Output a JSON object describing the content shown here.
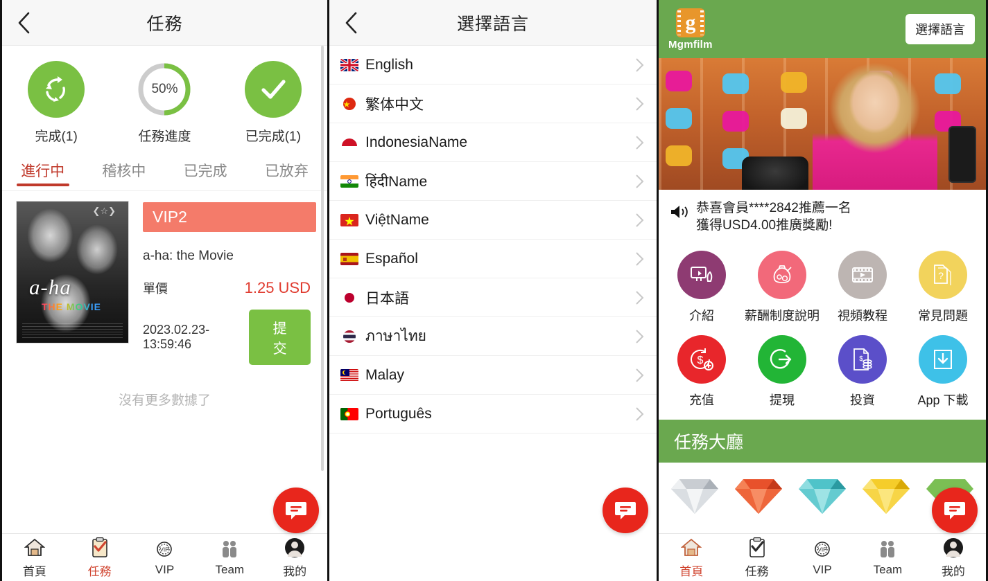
{
  "panel_tasks": {
    "navbar": {
      "title": "任務",
      "back_icon": "chevron-left-icon"
    },
    "stats": [
      {
        "label": "完成(1)",
        "icon": "recycle-arrows-icon",
        "type": "circle",
        "color": "#7ac043"
      },
      {
        "label": "任務進度",
        "value": "50%",
        "percent": 50,
        "type": "ring",
        "track_color": "#cccccc",
        "fill_color": "#7ac043"
      },
      {
        "label": "已完成(1)",
        "icon": "check-icon",
        "type": "circle",
        "color": "#7ac043"
      }
    ],
    "tabs": [
      {
        "label": "進行中",
        "active": true
      },
      {
        "label": "稽核中",
        "active": false
      },
      {
        "label": "已完成",
        "active": false
      },
      {
        "label": "已放弃",
        "active": false
      }
    ],
    "task": {
      "vip_badge": "VIP2",
      "movie_title": "a-ha: the Movie",
      "poster_title": "a-ha",
      "poster_subtitle": "THE MOVIE",
      "price_label": "單價",
      "price_value": "1.25 USD",
      "datetime": "2023.02.23-13:59:46",
      "submit_label": "提交"
    },
    "empty_text": "沒有更多數據了",
    "fab_icon": "chat-bubble-icon",
    "tabbar": [
      {
        "label": "首頁",
        "icon": "home-icon",
        "active": false
      },
      {
        "label": "任務",
        "icon": "clipboard-check-icon",
        "active": true
      },
      {
        "label": "VIP",
        "icon": "vip-badge-icon",
        "active": false
      },
      {
        "label": "Team",
        "icon": "people-icon",
        "active": false
      },
      {
        "label": "我的",
        "icon": "user-avatar-icon",
        "active": false
      }
    ]
  },
  "panel_language": {
    "navbar": {
      "title": "選擇語言",
      "back_icon": "chevron-left-icon"
    },
    "items": [
      {
        "label": "English",
        "flag": "flag-uk"
      },
      {
        "label": "繁体中文",
        "flag": "flag-china"
      },
      {
        "label": "IndonesiaName",
        "flag": "flag-indonesia"
      },
      {
        "label": "हिंदीName",
        "flag": "flag-india"
      },
      {
        "label": "ViệtName",
        "flag": "flag-vietnam"
      },
      {
        "label": "Español",
        "flag": "flag-spain"
      },
      {
        "label": "日本語",
        "flag": "flag-japan"
      },
      {
        "label": "ภาษาไทย",
        "flag": "flag-thailand"
      },
      {
        "label": "Malay",
        "flag": "flag-malaysia"
      },
      {
        "label": "Português",
        "flag": "flag-portugal"
      }
    ],
    "chevron_icon": "chevron-right-icon",
    "fab_icon": "chat-bubble-icon"
  },
  "panel_home": {
    "header": {
      "brand_mark": "g",
      "brand_name": "Mgmfilm",
      "language_button": "選擇語言",
      "background_color": "#6aa84f"
    },
    "notice": {
      "icon": "speaker-icon",
      "line1": "恭喜會員****2842推薦一名",
      "line2": "獲得USD4.00推廣獎勵!"
    },
    "shortcuts": [
      {
        "label": "介紹",
        "icon": "monitor-presentation-icon",
        "color": "#8e3b72"
      },
      {
        "label": "薪酬制度說明",
        "icon": "money-bag-icon",
        "color": "#f2697a"
      },
      {
        "label": "視頻教程",
        "icon": "video-play-icon",
        "color": "#bdb5b2"
      },
      {
        "label": "常見問題",
        "icon": "question-document-icon",
        "color": "#f2d35c"
      },
      {
        "label": "充值",
        "icon": "deposit-icon",
        "color": "#e8262b"
      },
      {
        "label": "提現",
        "icon": "withdraw-icon",
        "color": "#22b536"
      },
      {
        "label": "投資",
        "icon": "invest-document-icon",
        "color": "#5b4fc9"
      },
      {
        "label": "App 下載",
        "icon": "download-icon",
        "color": "#3ec1e8"
      }
    ],
    "lobby": {
      "title": "任務大廳",
      "background_color": "#6aa84f"
    },
    "diamonds": [
      {
        "name": "diamond-silver",
        "color": "#c9cdd2"
      },
      {
        "name": "diamond-orange",
        "color": "#e8512b"
      },
      {
        "name": "diamond-teal",
        "color": "#4fc3c9"
      },
      {
        "name": "diamond-gold",
        "color": "#f5cd2a"
      }
    ],
    "fab_icon": "chat-bubble-icon",
    "tabbar": [
      {
        "label": "首頁",
        "icon": "home-icon",
        "active": true
      },
      {
        "label": "任務",
        "icon": "clipboard-check-icon",
        "active": false
      },
      {
        "label": "VIP",
        "icon": "vip-badge-icon",
        "active": false
      },
      {
        "label": "Team",
        "icon": "people-icon",
        "active": false
      },
      {
        "label": "我的",
        "icon": "user-avatar-icon",
        "active": false
      }
    ]
  }
}
